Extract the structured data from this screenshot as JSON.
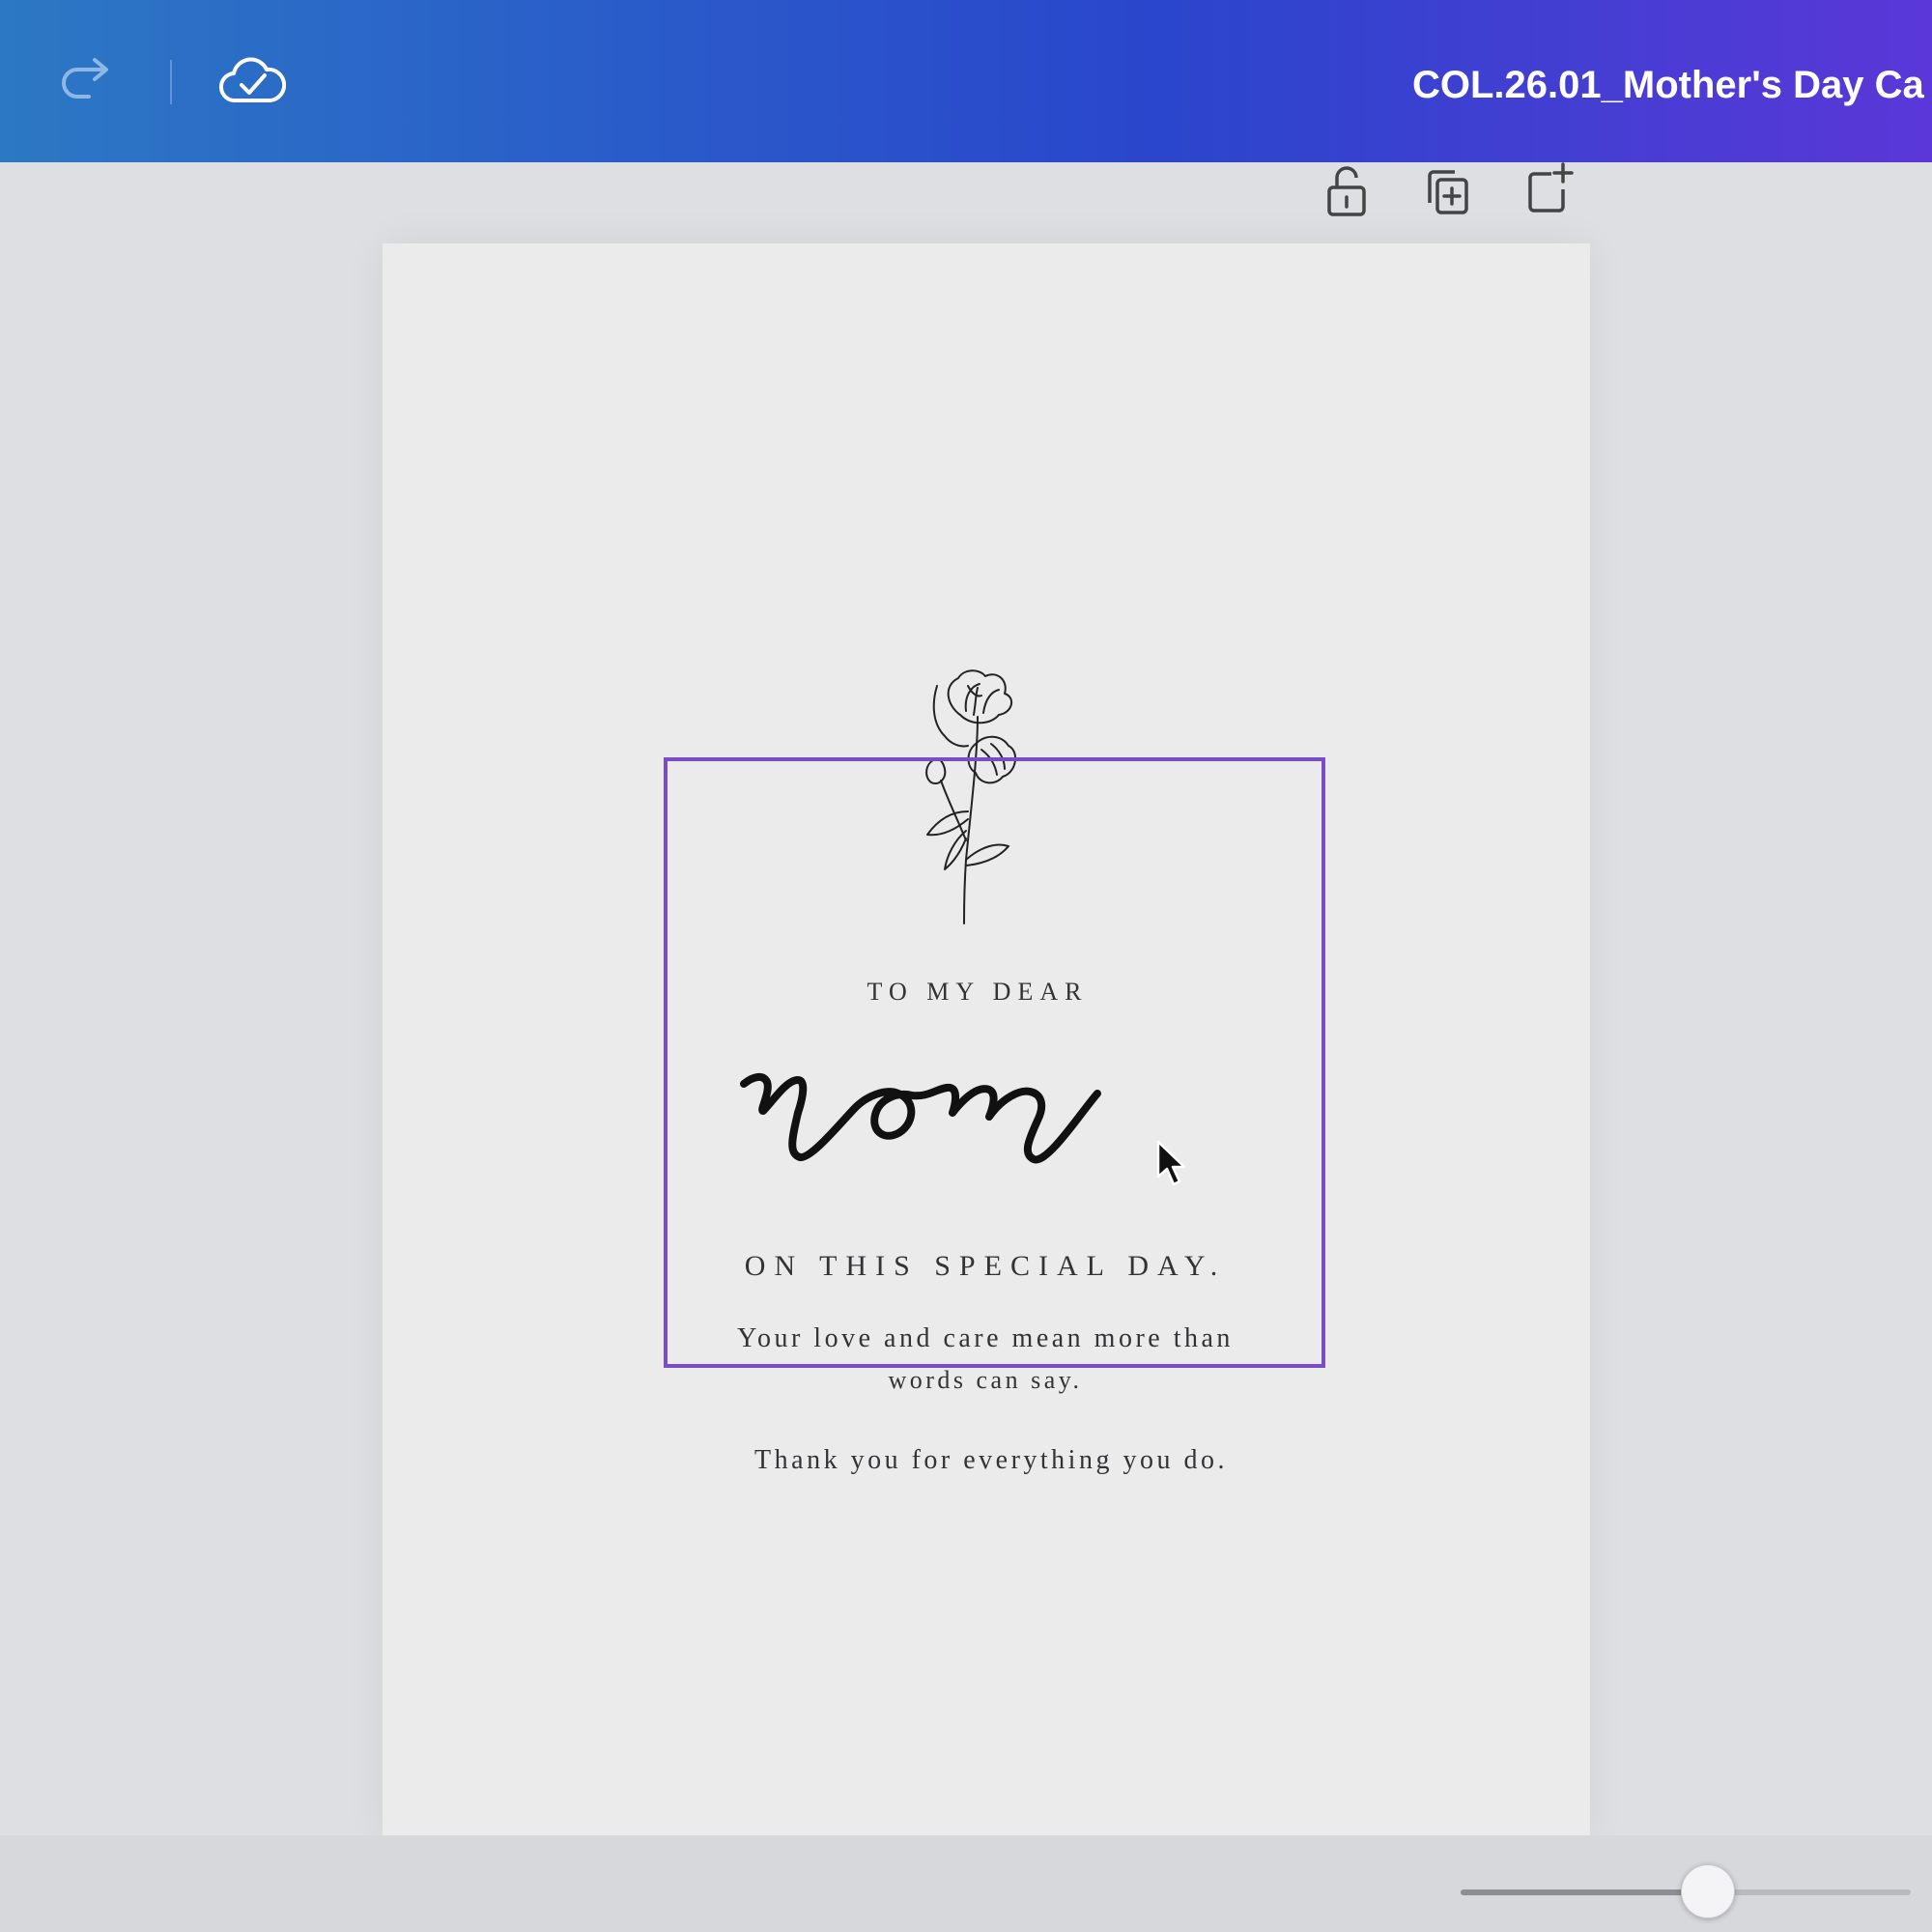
{
  "topbar": {
    "undo_icon": "redo-arrow-icon",
    "save_status_icon": "cloud-check-icon",
    "document_title": "COL.26.01_Mother's Day Ca"
  },
  "page_toolbar": {
    "lock_icon": "unlock-icon",
    "duplicate_icon": "duplicate-page-icon",
    "add_page_icon": "add-page-icon"
  },
  "card": {
    "line1": "TO MY DEAR",
    "script_word": "mom",
    "line2": "ON THIS SPECIAL DAY.",
    "line3": "Your love and care mean more than",
    "line4": "words can say.",
    "line5": "Thank you for everything you do.",
    "illustration": "flower-illustration"
  },
  "colors": {
    "topbar_start": "#2c78c4",
    "topbar_end": "#5a37d8",
    "selection_border": "#7a4cc5",
    "canvas_background": "#dedfe2",
    "page_background": "#ebebec"
  },
  "zoom": {
    "slider_level": 0.55
  }
}
